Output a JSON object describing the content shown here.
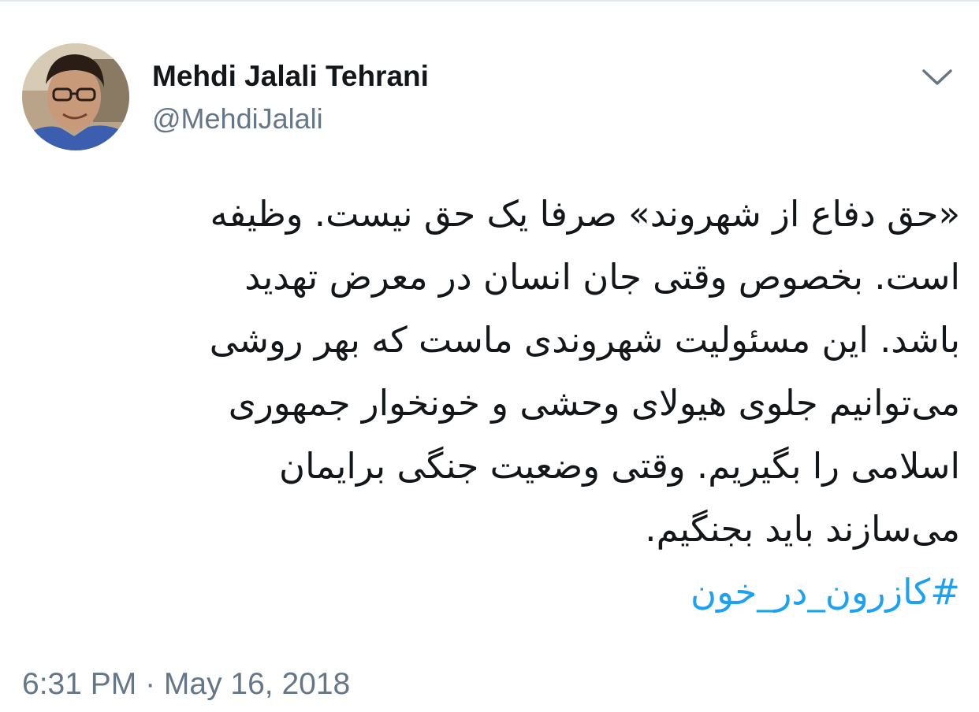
{
  "user": {
    "display_name": "Mehdi Jalali Tehrani",
    "handle": "@MehdiJalali",
    "avatar_icon": "profile-photo"
  },
  "header": {
    "menu_icon": "chevron-down-icon"
  },
  "tweet": {
    "lines": [
      "«حق دفاع از شهروند» صرفا یک حق نیست. وظیفه",
      "است. بخصوص وقتی جان انسان در معرض تهدید",
      "باشد. این مسئولیت شهروندی ماست که بهر روشی",
      "می‌توانیم جلوی هیولای وحشی و خونخوار جمهوری",
      "اسلامی را  بگیریم. وقتی وضعیت جنگی برایمان",
      "می‌سازند باید بجنگیم."
    ],
    "hashtag": "#کازرون_در_خون",
    "timestamp": "6:31 PM · May 16, 2018"
  },
  "colors": {
    "text": "#14171a",
    "secondary": "#657786",
    "link": "#1da1f2",
    "divider": "#e1e8ed"
  }
}
